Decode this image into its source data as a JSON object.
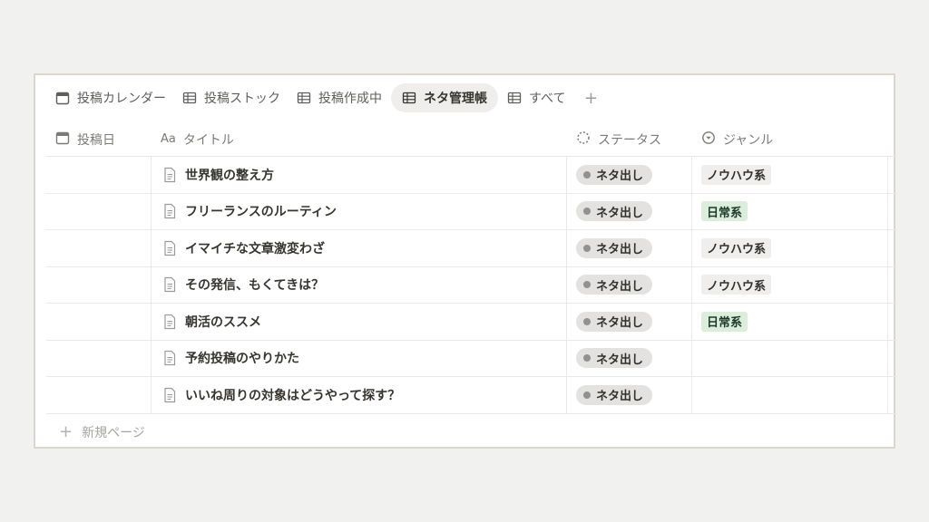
{
  "tabs": [
    {
      "label": "投稿カレンダー",
      "icon": "calendar-icon",
      "active": false
    },
    {
      "label": "投稿ストック",
      "icon": "table-icon",
      "active": false
    },
    {
      "label": "投稿作成中",
      "icon": "table-icon",
      "active": false
    },
    {
      "label": "ネタ管理帳",
      "icon": "table-icon",
      "active": true
    },
    {
      "label": "すべて",
      "icon": "table-icon",
      "active": false
    }
  ],
  "add_view_label": "+",
  "columns": {
    "date": {
      "label": "投稿日",
      "icon": "calendar-icon"
    },
    "title": {
      "label": "タイトル",
      "icon": "text-aa-icon",
      "icon_text": "Aa"
    },
    "status": {
      "label": "ステータス",
      "icon": "status-dashed-circle-icon"
    },
    "genre": {
      "label": "ジャンル",
      "icon": "select-chevron-circle-icon"
    }
  },
  "rows": [
    {
      "date": "",
      "title": "世界観の整え方",
      "status": "ネタ出し",
      "genre": "ノウハウ系"
    },
    {
      "date": "",
      "title": "フリーランスのルーティン",
      "status": "ネタ出し",
      "genre": "日常系"
    },
    {
      "date": "",
      "title": "イマイチな文章激変わざ",
      "status": "ネタ出し",
      "genre": "ノウハウ系"
    },
    {
      "date": "",
      "title": "その発信、もくてきは？",
      "status": "ネタ出し",
      "genre": "ノウハウ系"
    },
    {
      "date": "",
      "title": "朝活のススメ",
      "status": "ネタ出し",
      "genre": "日常系"
    },
    {
      "date": "",
      "title": "予約投稿のやりかた",
      "status": "ネタ出し",
      "genre": ""
    },
    {
      "date": "",
      "title": "いいね周りの対象はどうやって探す？",
      "status": "ネタ出し",
      "genre": ""
    }
  ],
  "new_page_label": "新規ページ",
  "colors": {
    "status_pill_bg": "#e3e2e0",
    "status_dot": "#91918e",
    "tag_knowhow_bg": "#efeeec",
    "tag_daily_bg": "#dbeddb",
    "active_tab_bg": "#efeeec",
    "frame_border": "#dcd6cf"
  }
}
